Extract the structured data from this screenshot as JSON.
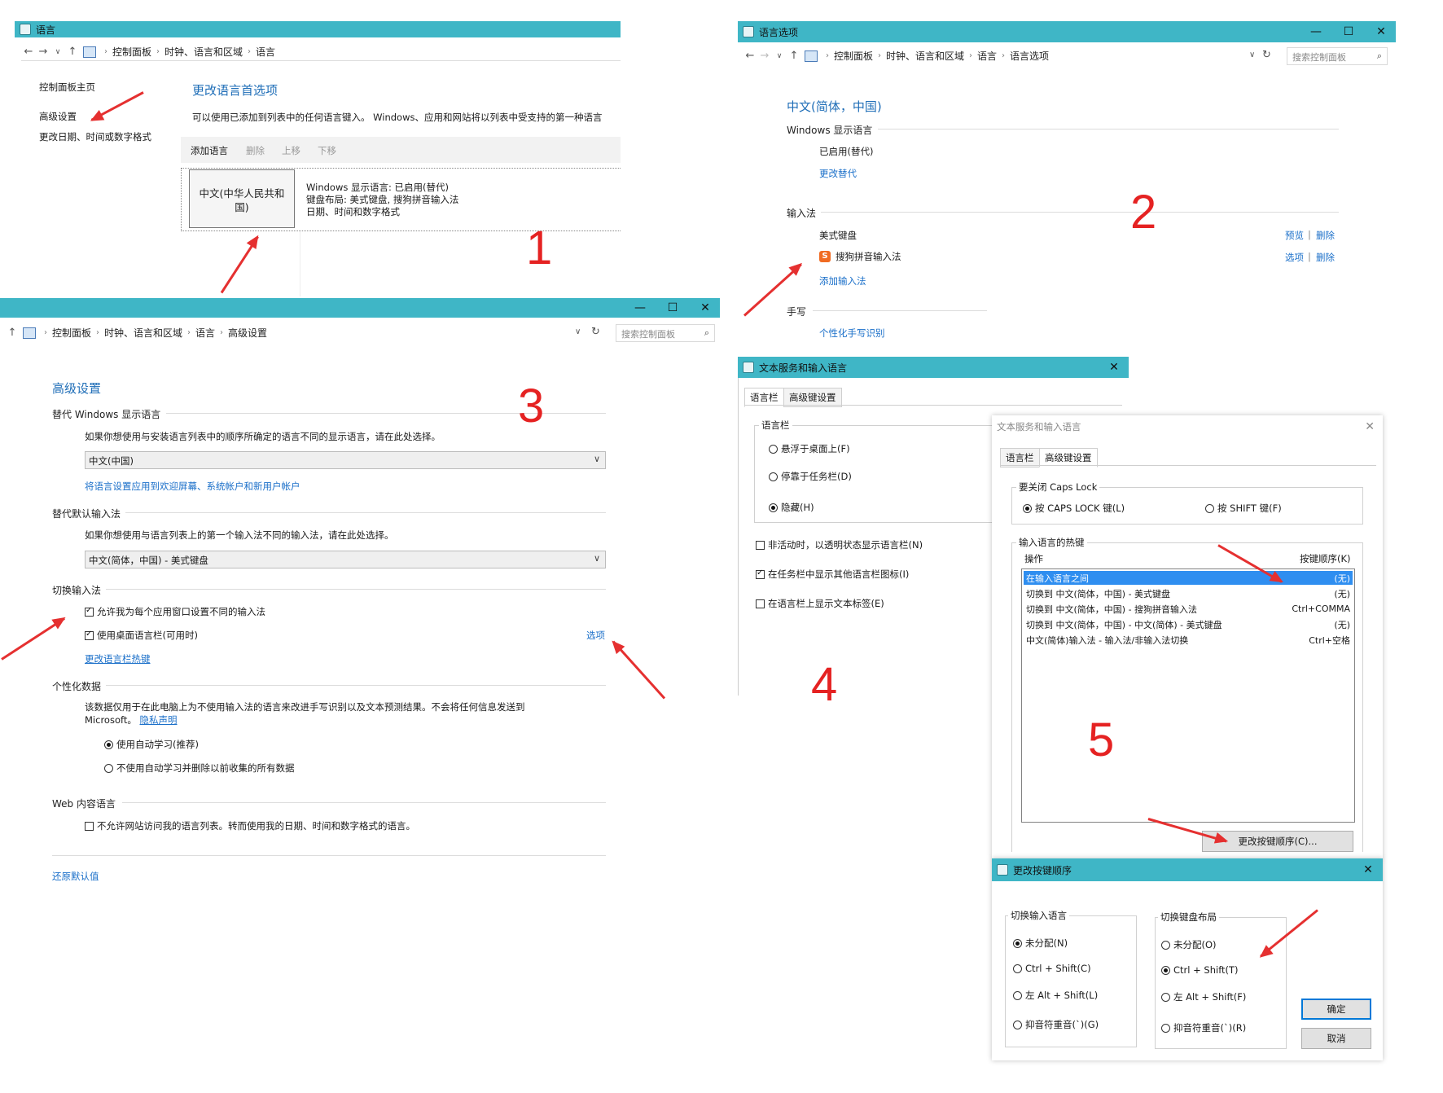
{
  "w1": {
    "title": "语言",
    "breadcrumb": [
      "控制面板",
      "时钟、语言和区域",
      "语言"
    ],
    "sidebar": [
      "控制面板主页",
      "高级设置",
      "更改日期、时间或数字格式"
    ],
    "heading": "更改语言首选项",
    "desc": "可以使用已添加到列表中的任何语言键入。 Windows、应用和网站将以列表中受支持的第一种语言",
    "toolbar": [
      "添加语言",
      "删除",
      "上移",
      "下移"
    ],
    "lang_tile": "中文(中华人民共和国)",
    "lang_info": [
      "Windows 显示语言: 已启用(替代)",
      "键盘布局: 美式键盘, 搜狗拼音输入法",
      "日期、时间和数字格式"
    ]
  },
  "w2": {
    "title": "语言选项",
    "breadcrumb": [
      "控制面板",
      "时钟、语言和区域",
      "语言",
      "语言选项"
    ],
    "search_placeholder": "搜索控制面板",
    "heading": "中文(简体，中国)",
    "display_section": "Windows 显示语言",
    "display_status": "已启用(替代)",
    "change_override": "更改替代",
    "ime_section": "输入法",
    "ime_items": [
      {
        "name": "美式键盘",
        "action1": "预览",
        "action2": "删除"
      },
      {
        "name": "搜狗拼音输入法",
        "action1": "选项",
        "action2": "删除"
      }
    ],
    "add_ime": "添加输入法",
    "hw_section": "手写",
    "hw_link": "个性化手写识别"
  },
  "w3": {
    "breadcrumb": [
      "控制面板",
      "时钟、语言和区域",
      "语言",
      "高级设置"
    ],
    "search_placeholder": "搜索控制面板",
    "heading": "高级设置",
    "s1_title": "替代 Windows 显示语言",
    "s1_desc": "如果你想使用与安装语言列表中的顺序所确定的语言不同的显示语言，请在此处选择。",
    "s1_select": "中文(中国)",
    "s1_link": "将语言设置应用到欢迎屏幕、系统帐户和新用户帐户",
    "s2_title": "替代默认输入法",
    "s2_desc": "如果你想使用与语言列表上的第一个输入法不同的输入法，请在此处选择。",
    "s2_select": "中文(简体，中国) - 美式键盘",
    "s3_title": "切换输入法",
    "s3_cb1": "允许我为每个应用窗口设置不同的输入法",
    "s3_cb2": "使用桌面语言栏(可用时)",
    "s3_options": "选项",
    "s3_link": "更改语言栏热键",
    "s4_title": "个性化数据",
    "s4_desc1": "该数据仅用于在此电脑上为不使用输入法的语言来改进手写识别以及文本预测结果。不会将任何信息发送到",
    "s4_desc2": "Microsoft。",
    "s4_privacy": "隐私声明",
    "s4_r1": "使用自动学习(推荐)",
    "s4_r2": "不使用自动学习并删除以前收集的所有数据",
    "s5_title": "Web 内容语言",
    "s5_cb": "不允许网站访问我的语言列表。转而使用我的日期、时间和数字格式的语言。",
    "restore": "还原默认值"
  },
  "w4": {
    "title": "文本服务和输入语言",
    "tabs": [
      "语言栏",
      "高级键设置"
    ],
    "group": "语言栏",
    "r1": "悬浮于桌面上(F)",
    "r2": "停靠于任务栏(D)",
    "r3": "隐藏(H)",
    "cb1": "非活动时，以透明状态显示语言栏(N)",
    "cb2": "在任务栏中显示其他语言栏图标(I)",
    "cb3": "在语言栏上显示文本标签(E)"
  },
  "w5": {
    "title": "文本服务和输入语言",
    "tabs": [
      "语言栏",
      "高级键设置"
    ],
    "caps_group": "要关闭 Caps Lock",
    "caps_r1": "按 CAPS LOCK 键(L)",
    "caps_r2": "按 SHIFT 键(F)",
    "hk_group": "输入语言的热键",
    "col_action": "操作",
    "col_keys": "按键顺序(K)",
    "rows": [
      {
        "action": "在输入语言之间",
        "keys": "(无)"
      },
      {
        "action": "切换到 中文(简体，中国) - 美式键盘",
        "keys": "(无)"
      },
      {
        "action": "切换到 中文(简体，中国) - 搜狗拼音输入法",
        "keys": "Ctrl+COMMA"
      },
      {
        "action": "切换到 中文(简体，中国) - 中文(简体) - 美式键盘",
        "keys": "(无)"
      },
      {
        "action": "中文(简体)输入法 - 输入法/非输入法切换",
        "keys": "Ctrl+空格"
      }
    ],
    "change_btn": "更改按键顺序(C)..."
  },
  "w6": {
    "title": "更改按键顺序",
    "g1": "切换输入语言",
    "g1_opts": [
      "未分配(N)",
      "Ctrl + Shift(C)",
      "左 Alt + Shift(L)",
      "抑音符重音(`)(G)"
    ],
    "g2": "切换键盘布局",
    "g2_opts": [
      "未分配(O)",
      "Ctrl + Shift(T)",
      "左 Alt + Shift(F)",
      "抑音符重音(`)(R)"
    ],
    "ok": "确定",
    "cancel": "取消"
  },
  "labels": [
    "1",
    "2",
    "3",
    "4",
    "5"
  ],
  "accent_color": "#3fb6c6",
  "annotation_color": "#e52222"
}
